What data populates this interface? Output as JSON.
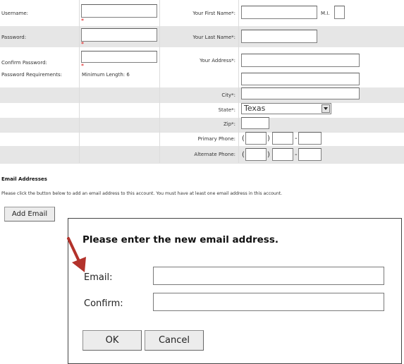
{
  "form": {
    "username_label": "Username:",
    "password_label": "Password:",
    "confirm_password_label": "Confirm Password:",
    "password_req_label": "Password Requirements:",
    "password_req_value": "Minimum Length: 6",
    "first_name_label": "Your First Name*:",
    "mi_label": "M.I.",
    "last_name_label": "Your Last Name*:",
    "address_label": "Your Address*:",
    "city_label": "City*:",
    "state_label": "State*:",
    "state_value": "Texas",
    "zip_label": "Zip*:",
    "primary_phone_label": "Primary Phone:",
    "alternate_phone_label": "Alternate Phone:",
    "required_mark": "*",
    "paren_open": "(",
    "paren_close": ")",
    "dash": "-"
  },
  "email_section": {
    "heading": "Email Addresses",
    "instructions": "Please click the button below to add an email address to this account. You must have at least one email address in this account.",
    "add_button": "Add Email"
  },
  "dialog": {
    "title": "Please enter the new email address.",
    "email_label": "Email:",
    "confirm_label": "Confirm:",
    "email_value": "",
    "confirm_value": "",
    "ok_button": "OK",
    "cancel_button": "Cancel"
  },
  "colors": {
    "band": "#e6e6e6",
    "annotation_arrow": "#b3322b"
  }
}
